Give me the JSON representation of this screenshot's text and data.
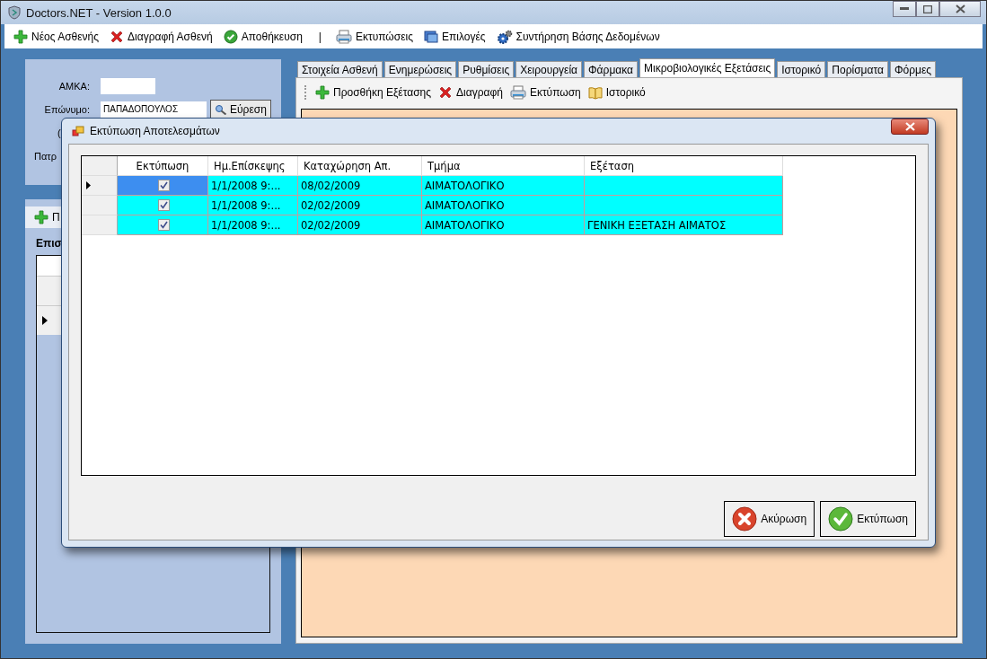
{
  "window": {
    "title": "Doctors.NET - Version 1.0.0"
  },
  "toolbar": [
    {
      "label": "Νέος Ασθενής",
      "kind": "add"
    },
    {
      "label": "Διαγραφή Ασθενή",
      "kind": "delete"
    },
    {
      "label": "Αποθήκευση",
      "kind": "save"
    },
    {
      "label": "|",
      "kind": "separator"
    },
    {
      "label": "Εκτυπώσεις",
      "kind": "print"
    },
    {
      "label": "Επιλογές",
      "kind": "options"
    },
    {
      "label": "Συντήρηση Βάσης Δεδομένων",
      "kind": "maintenance"
    }
  ],
  "patient_panel": {
    "amka_label": "ΑΜΚΑ:",
    "surname_label": "Επώνυμο:",
    "surname_value": "ΠΑΠΑΔΟΠΟΥΛΟΣ",
    "find_button": "Εύρεση",
    "label_3": "(",
    "label_4": "Πατρ"
  },
  "visits_panel": {
    "add_button": "Π",
    "grid_label": "Επισ"
  },
  "tabs": [
    {
      "label": "Στοιχεία Ασθενή",
      "selected": false
    },
    {
      "label": "Ενημερώσεις",
      "selected": false
    },
    {
      "label": "Ρυθμίσεις",
      "selected": false
    },
    {
      "label": "Χειρουργεία",
      "selected": false
    },
    {
      "label": "Φάρμακα",
      "selected": false
    },
    {
      "label": "Μικροβιολογικές Εξετάσεις",
      "selected": true
    },
    {
      "label": "Ιστορικό",
      "selected": false
    },
    {
      "label": "Πορίσματα",
      "selected": false
    },
    {
      "label": "Φόρμες",
      "selected": false
    }
  ],
  "exams_toolbar": [
    {
      "label": "Προσθήκη Εξέτασης",
      "kind": "add"
    },
    {
      "label": "Διαγραφή",
      "kind": "delete"
    },
    {
      "label": "Εκτύπωση",
      "kind": "print"
    },
    {
      "label": "Ιστορικό",
      "kind": "history"
    }
  ],
  "dialog": {
    "title": "Εκτύπωση Αποτελεσμάτων",
    "columns": [
      "Εκτύπωση",
      "Ημ.Επίσκεψης",
      "Καταχώρηση Απ.",
      "Τμήμα",
      "Εξέταση"
    ],
    "rows": [
      {
        "selected": true,
        "checked": true,
        "visit": "1/1/2008 9:...",
        "registration": "08/02/2009",
        "department": "ΑΙΜΑΤΟΛΟΓΙΚΟ"
      },
      {
        "selected": false,
        "checked": true,
        "visit": "1/1/2008 9:...",
        "registration": "02/02/2009",
        "department": "ΑΙΜΑΤΟΛΟΓΙΚΟ"
      },
      {
        "selected": false,
        "checked": true,
        "visit": "1/1/2008 9:...",
        "registration": "02/02/2009",
        "department": "ΑΙΜΑΤΟΛΟΓΙΚΟ",
        "exam": "ΓΕΝΙΚΗ ΕΞΕΤΑΣΗ ΑΙΜΑΤΟΣ"
      }
    ],
    "buttons": [
      {
        "label": "Ακύρωση",
        "kind": "cancel"
      },
      {
        "label": "Εκτύπωση",
        "kind": "print"
      }
    ]
  }
}
